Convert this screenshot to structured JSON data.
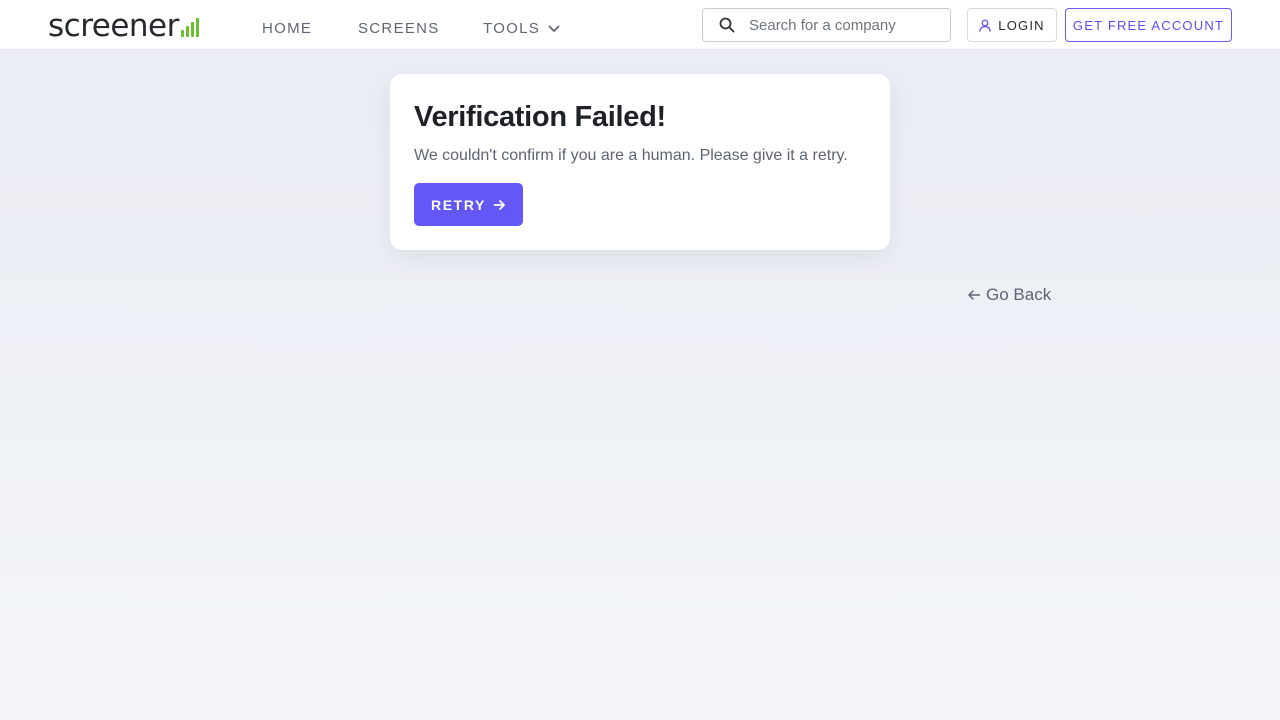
{
  "header": {
    "logo_text": "screener",
    "nav": [
      {
        "label": "HOME"
      },
      {
        "label": "SCREENS"
      },
      {
        "label": "TOOLS"
      }
    ],
    "search": {
      "placeholder": "Search for a company",
      "value": ""
    },
    "login_label": "LOGIN",
    "free_account_label": "GET FREE ACCOUNT"
  },
  "card": {
    "title": "Verification Failed!",
    "message": "We couldn't confirm if you are a human. Please give it a retry.",
    "retry_label": "RETRY"
  },
  "go_back_label": "Go Back",
  "colors": {
    "accent": "#6457f7",
    "logo_bars": "#6bbf2f",
    "background": "#eceff5"
  },
  "icons": {
    "search": "search-icon",
    "tools_dropdown": "chevron-down-icon",
    "login": "user-icon",
    "retry": "arrow-right-icon",
    "back": "arrow-left-icon"
  }
}
